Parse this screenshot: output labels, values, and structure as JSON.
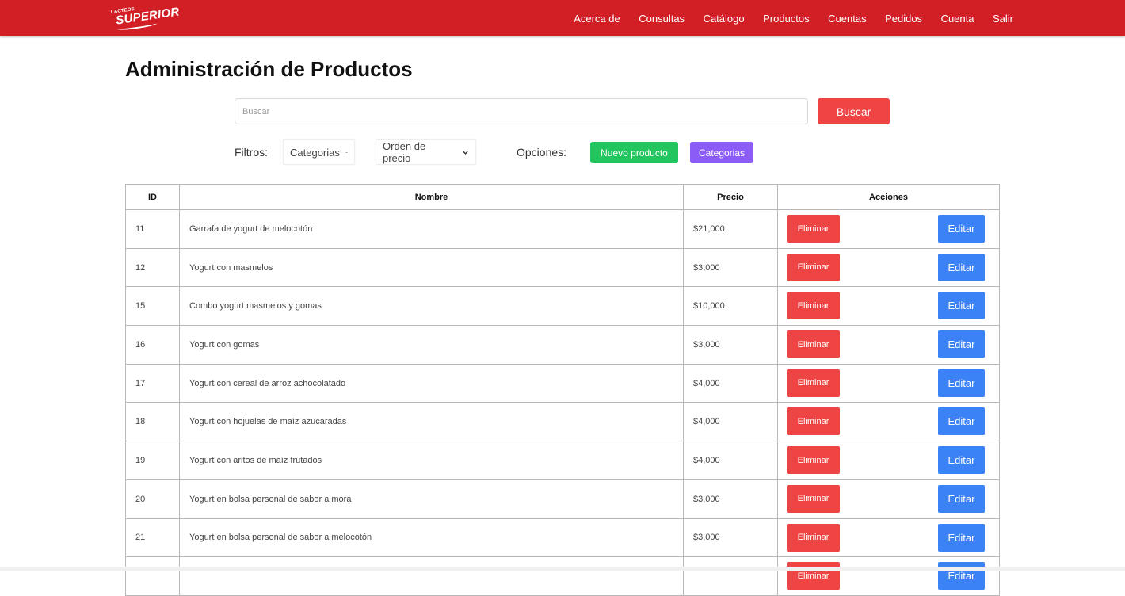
{
  "header": {
    "logo_small": "LACTEOS",
    "logo_text": "SUPERIOR",
    "nav": [
      "Acerca de",
      "Consultas",
      "Catálogo",
      "Productos",
      "Cuentas",
      "Pedidos",
      "Cuenta",
      "Salir"
    ],
    "color": "#d21f26"
  },
  "page": {
    "title": "Administración de Productos"
  },
  "search": {
    "placeholder": "Buscar",
    "value": "",
    "button_label": "Buscar"
  },
  "filters": {
    "label": "Filtros:",
    "category_select": "Categorias",
    "price_select": "Orden de precio"
  },
  "options": {
    "label": "Opciones:",
    "new_product_label": "Nuevo producto",
    "categories_label": "Categorias"
  },
  "table": {
    "headers": {
      "id": "ID",
      "name": "Nombre",
      "price": "Precio",
      "actions": "Acciones"
    },
    "delete_label": "Eliminar",
    "edit_label": "Editar",
    "rows": [
      {
        "id": "11",
        "name": "Garrafa de yogurt de melocotón",
        "price": "$21,000"
      },
      {
        "id": "12",
        "name": "Yogurt con masmelos",
        "price": "$3,000"
      },
      {
        "id": "15",
        "name": "Combo yogurt masmelos y gomas",
        "price": "$10,000"
      },
      {
        "id": "16",
        "name": "Yogurt con gomas",
        "price": "$3,000"
      },
      {
        "id": "17",
        "name": "Yogurt con cereal de arroz achocolatado",
        "price": "$4,000"
      },
      {
        "id": "18",
        "name": "Yogurt con hojuelas de maíz azucaradas",
        "price": "$4,000"
      },
      {
        "id": "19",
        "name": "Yogurt con aritos de maíz frutados",
        "price": "$4,000"
      },
      {
        "id": "20",
        "name": "Yogurt en bolsa personal de sabor a mora",
        "price": "$3,000"
      },
      {
        "id": "21",
        "name": "Yogurt en bolsa personal de sabor a melocotón",
        "price": "$3,000"
      },
      {
        "id": "",
        "name": "",
        "price": ""
      }
    ]
  },
  "colors": {
    "danger": "#ef4444",
    "primary": "#3b82f6",
    "success": "#22c55e",
    "purple": "#8b5cf6"
  }
}
